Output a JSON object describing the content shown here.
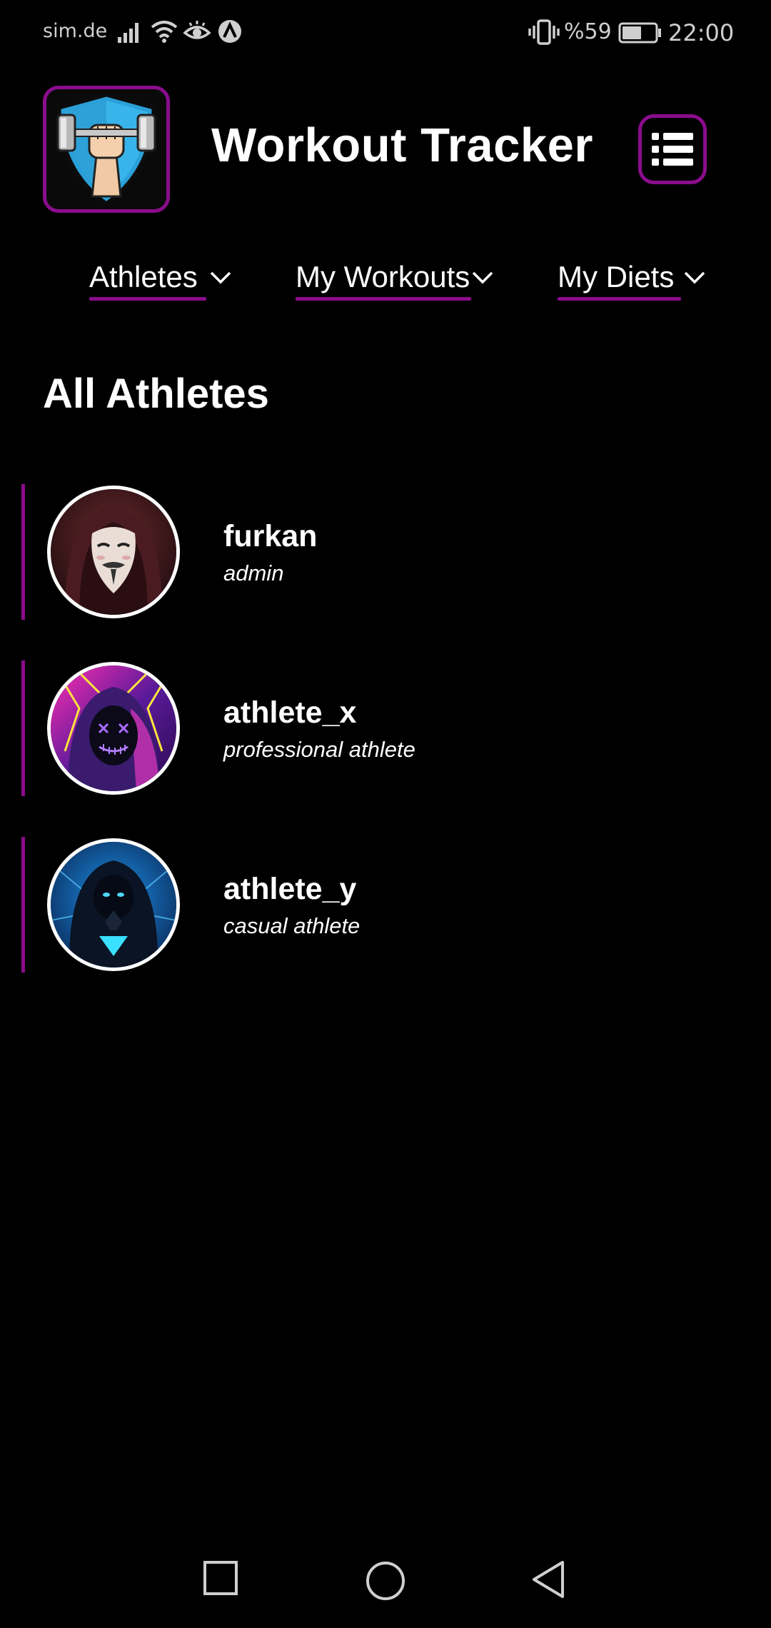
{
  "status_bar": {
    "carrier": "sim.de",
    "battery_percent": "%59",
    "battery_level": 0.59,
    "time": "22:00",
    "icons": [
      "signal-icon",
      "wifi-icon",
      "eye-comfort-icon",
      "a-icon",
      "vibrate-icon",
      "battery-icon"
    ]
  },
  "header": {
    "logo_icon": "dumbbell-fist-shield-icon",
    "title": "Workout Tracker",
    "menu_icon": "list-menu-icon"
  },
  "nav": {
    "items": [
      {
        "label": "Athletes",
        "icon": "chevron-down-icon"
      },
      {
        "label": "My Workouts",
        "icon": "chevron-down-icon"
      },
      {
        "label": "My Diets",
        "icon": "chevron-down-icon"
      }
    ]
  },
  "main": {
    "section_title": "All Athletes",
    "athletes": [
      {
        "name": "furkan",
        "role": "admin"
      },
      {
        "name": "athlete_x",
        "role": "professional athlete"
      },
      {
        "name": "athlete_y",
        "role": "casual athlete"
      }
    ]
  },
  "system_nav": {
    "icons": [
      "recent-apps-icon",
      "home-icon",
      "back-icon"
    ]
  },
  "colors": {
    "background": "#000000",
    "accent": "#8a0d8c",
    "text": "#ffffff",
    "status_text": "#cfcfcf"
  }
}
